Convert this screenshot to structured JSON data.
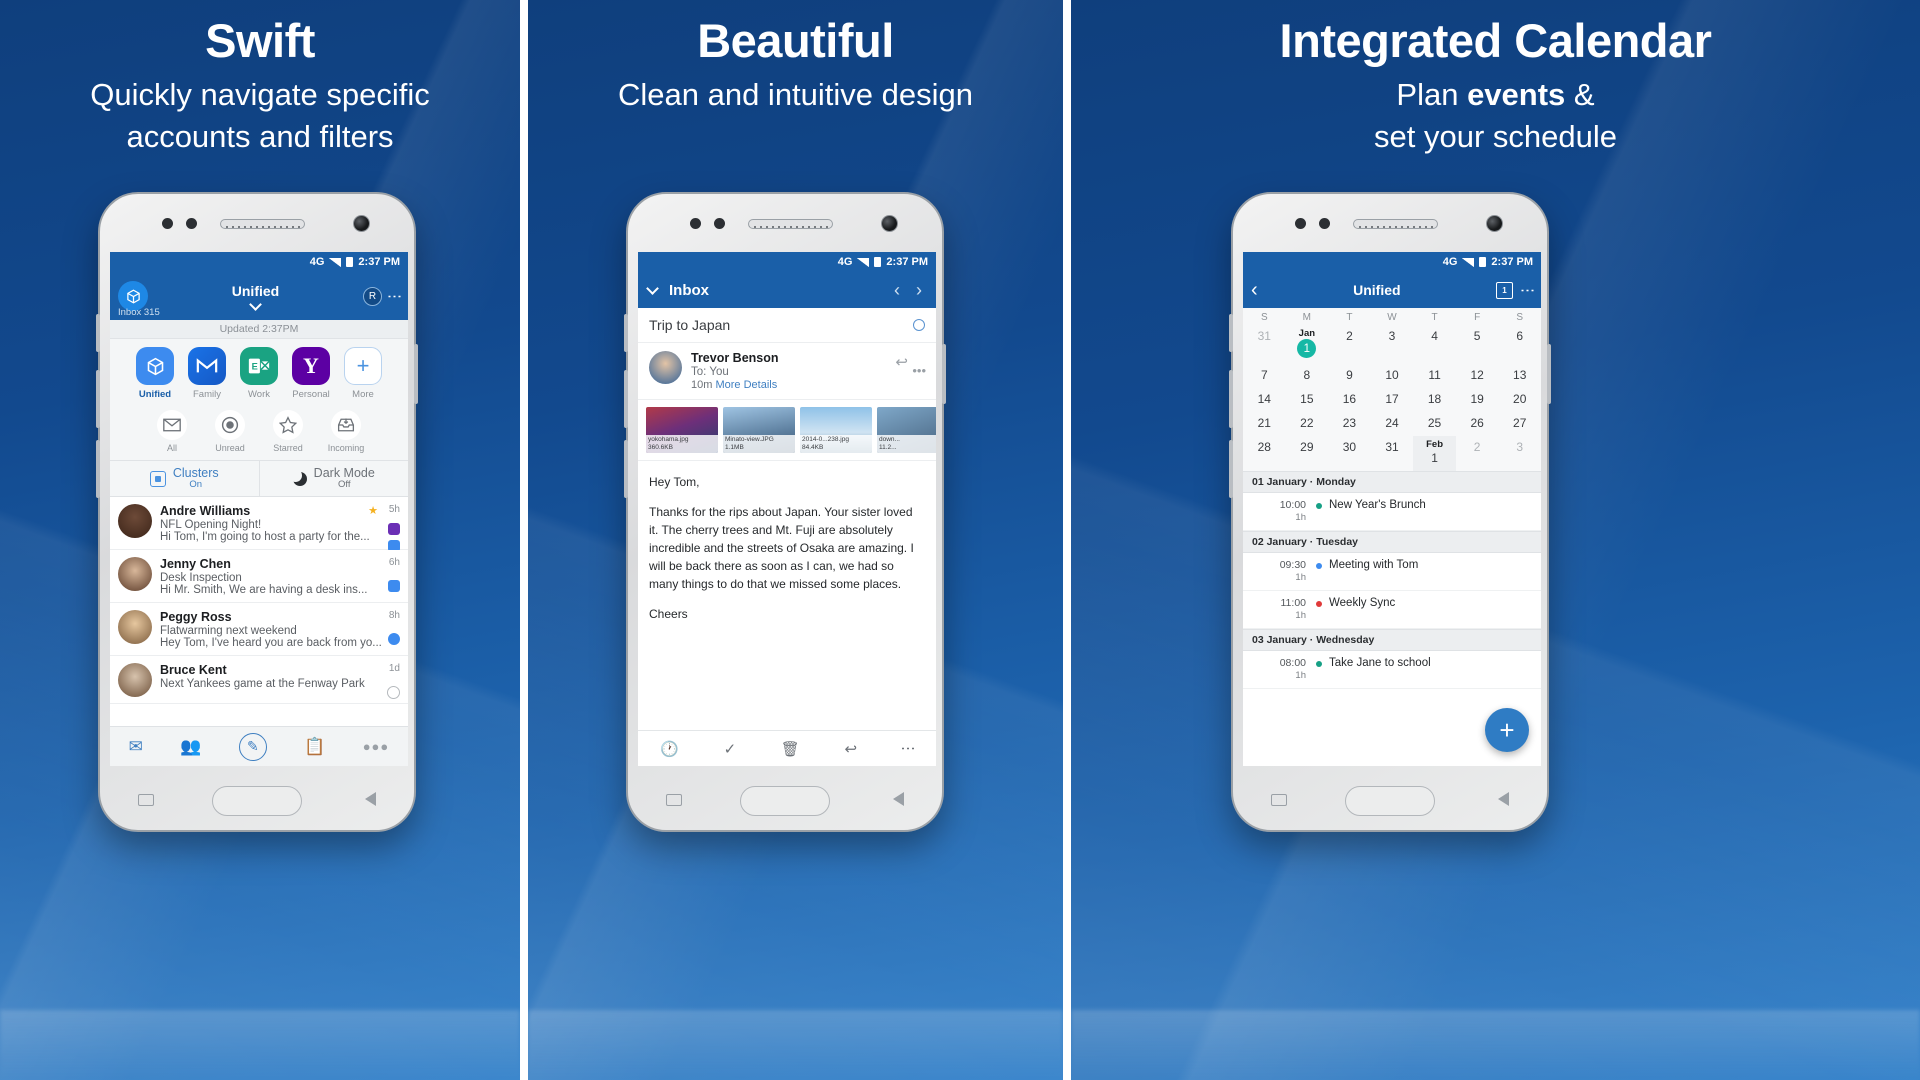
{
  "panels": [
    {
      "title": "Swift",
      "subtitle_line1": "Quickly navigate specific",
      "subtitle_line2": "accounts and filters"
    },
    {
      "title": "Beautiful",
      "subtitle_line1": "Clean and intuitive design",
      "subtitle_line2": ""
    },
    {
      "title": "Integrated Calendar",
      "subtitle_line1_a": "Plan ",
      "subtitle_line1_b": "events",
      "subtitle_line1_c": " &",
      "subtitle_line2": "set your schedule"
    }
  ],
  "status": {
    "network": "4G",
    "time": "2:37 PM"
  },
  "phone1": {
    "appbar": {
      "title": "Unified",
      "inbox_label": "Inbox 315",
      "avatar_letter": "R",
      "overflow": "⋮"
    },
    "updated": "Updated 2:37PM",
    "accounts": [
      {
        "name": "Unified",
        "icon": "cube-icon",
        "selected": true
      },
      {
        "name": "Family",
        "icon": "gmail-icon",
        "selected": false
      },
      {
        "name": "Work",
        "icon": "exchange-icon",
        "selected": false
      },
      {
        "name": "Personal",
        "icon": "yahoo-icon",
        "selected": false
      },
      {
        "name": "More",
        "icon": "plus-icon",
        "selected": false
      }
    ],
    "filters": [
      {
        "name": "All",
        "icon": "envelope-icon"
      },
      {
        "name": "Unread",
        "icon": "unread-dot-icon"
      },
      {
        "name": "Starred",
        "icon": "star-icon"
      },
      {
        "name": "Incoming",
        "icon": "inbox-down-icon"
      }
    ],
    "toggles": [
      {
        "label": "Clusters",
        "state": "On",
        "icon": "clusters-icon"
      },
      {
        "label": "Dark Mode",
        "state": "Off",
        "icon": "moon-icon"
      }
    ],
    "mails": [
      {
        "name": "Andre Williams",
        "subject": "NFL Opening Night!",
        "preview": "Hi Tom, I'm going to host a party for the...",
        "time": "5h",
        "starred": true
      },
      {
        "name": "Jenny Chen",
        "subject": "Desk Inspection",
        "preview": "Hi Mr. Smith, We are having a desk ins...",
        "time": "6h",
        "starred": false
      },
      {
        "name": "Peggy Ross",
        "subject": "Flatwarming next weekend",
        "preview": "Hey Tom, I've heard you are back from yo...",
        "time": "8h",
        "starred": false
      },
      {
        "name": "Bruce Kent",
        "subject": "Next Yankees game at the Fenway Park",
        "preview": "",
        "time": "1d",
        "starred": false
      }
    ],
    "bottombar": [
      {
        "icon": "mail-icon"
      },
      {
        "icon": "people-icon"
      },
      {
        "icon": "compose-icon"
      },
      {
        "icon": "clipboard-icon"
      },
      {
        "icon": "more-dots-icon"
      }
    ]
  },
  "phone2": {
    "appbar": {
      "title": "Inbox",
      "back_icon": "chevron-down-icon",
      "prev": "‹",
      "next": "›"
    },
    "subject": "Trip to Japan",
    "sender": {
      "name": "Trevor Benson",
      "to": "To: You",
      "time": "10m",
      "more": "More Details"
    },
    "attachments": [
      {
        "filename": "yokohama.jpg",
        "size": "360.6KB"
      },
      {
        "filename": "Minato-view.JPG",
        "size": "1.1MB"
      },
      {
        "filename": "2014-0...238.jpg",
        "size": "84.4KB"
      },
      {
        "filename": "down...",
        "size": "11.2..."
      }
    ],
    "body": [
      "Hey Tom,",
      "Thanks for the rips about Japan. Your sister loved it. The cherry trees and Mt. Fuji are absolutely incredible and the streets of Osaka are amazing. I will be back there as soon as I can, we had so many things to do that we missed some places.",
      "Cheers"
    ],
    "toolbar": [
      {
        "icon": "snooze-icon"
      },
      {
        "icon": "check-icon"
      },
      {
        "icon": "trash-icon"
      },
      {
        "icon": "reply-all-icon"
      },
      {
        "icon": "overflow-icon"
      }
    ]
  },
  "phone3": {
    "appbar": {
      "back": "‹",
      "title": "Unified",
      "calendar_icon": "calendar-icon",
      "calendar_day": "1",
      "overflow": "⋮"
    },
    "dow": [
      "S",
      "M",
      "T",
      "W",
      "T",
      "F",
      "S"
    ],
    "weeks": [
      [
        {
          "d": "31",
          "mut": true
        },
        {
          "d": "1",
          "month": "Jan",
          "sel": true
        },
        {
          "d": "2",
          "dot": "#3d8bef"
        },
        {
          "d": "3",
          "dot": "#e03a3a"
        },
        {
          "d": "4",
          "dot": "#16a085"
        },
        {
          "d": "5",
          "dot": "#3d8bef"
        },
        {
          "d": "6"
        }
      ],
      [
        {
          "d": "7"
        },
        {
          "d": "8",
          "dot": "#e03a3a"
        },
        {
          "d": "9",
          "dot": "#16a085"
        },
        {
          "d": "10",
          "dot": "#3d8bef"
        },
        {
          "d": "11"
        },
        {
          "d": "12",
          "dot": "#e03a3a"
        },
        {
          "d": "13",
          "dot": "#16a085"
        }
      ],
      [
        {
          "d": "14"
        },
        {
          "d": "15",
          "dot": "#16a085"
        },
        {
          "d": "16"
        },
        {
          "d": "17",
          "dot": "#e03a3a"
        },
        {
          "d": "18",
          "dot": "#3d8bef"
        },
        {
          "d": "19",
          "dot": "#16a085"
        },
        {
          "d": "20"
        }
      ],
      [
        {
          "d": "21"
        },
        {
          "d": "22",
          "dot": "#e03a3a"
        },
        {
          "d": "23",
          "dot": "#3d8bef"
        },
        {
          "d": "24",
          "dot": "#16a085"
        },
        {
          "d": "25"
        },
        {
          "d": "26",
          "dot": "#e03a3a"
        },
        {
          "d": "27"
        }
      ],
      [
        {
          "d": "28"
        },
        {
          "d": "29",
          "dot": "#16a085"
        },
        {
          "d": "30"
        },
        {
          "d": "31",
          "dot": "#3d8bef"
        },
        {
          "d": "1",
          "month": "Feb",
          "today": true
        },
        {
          "d": "2",
          "mut": true
        },
        {
          "d": "3",
          "mut": true
        }
      ]
    ],
    "days": [
      {
        "header": "01 January · Monday",
        "events": [
          {
            "time": "10:00",
            "dur": "1h",
            "title": "New Year's Brunch",
            "color": "#16a085"
          }
        ]
      },
      {
        "header": "02 January · Tuesday",
        "events": [
          {
            "time": "09:30",
            "dur": "1h",
            "title": "Meeting with Tom",
            "color": "#3d8bef"
          },
          {
            "time": "11:00",
            "dur": "1h",
            "title": "Weekly Sync",
            "color": "#e03a3a"
          }
        ]
      },
      {
        "header": "03 January · Wednesday",
        "events": [
          {
            "time": "08:00",
            "dur": "1h",
            "title": "Take Jane to school",
            "color": "#16a085"
          }
        ]
      }
    ],
    "fab": "+"
  }
}
